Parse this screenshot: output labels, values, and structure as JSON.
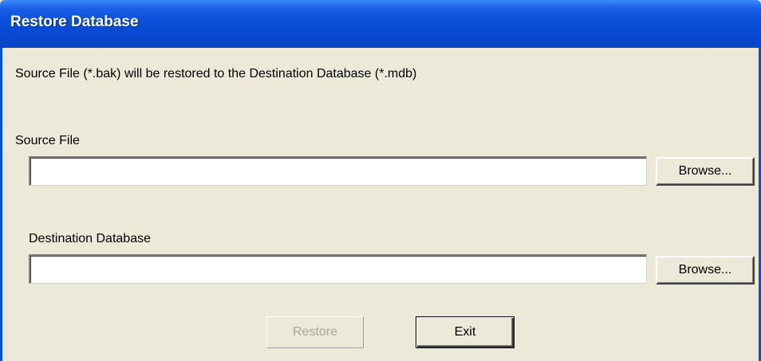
{
  "window": {
    "title": "Restore Database"
  },
  "dialog": {
    "description": "Source File (*.bak) will be restored to the Destination Database (*.mdb)",
    "source_file": {
      "label": "Source File",
      "value": "",
      "browse_label": "Browse..."
    },
    "destination_database": {
      "label": "Destination Database",
      "value": "",
      "browse_label": "Browse..."
    },
    "buttons": {
      "restore_label": "Restore",
      "restore_enabled": false,
      "exit_label": "Exit"
    }
  },
  "colors": {
    "titlebar": "#0a4fd8",
    "window_bg": "#ece9d8",
    "disabled_text": "#a8a69a"
  }
}
